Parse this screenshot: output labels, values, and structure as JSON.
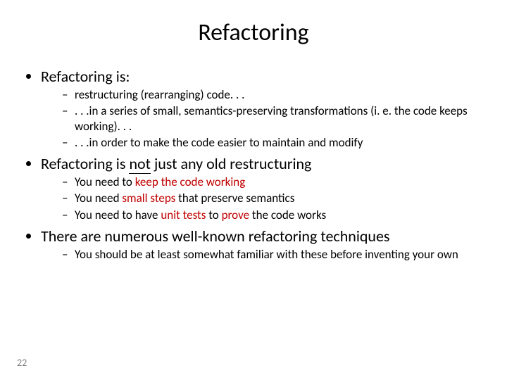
{
  "title": "Refactoring",
  "page_number": "22",
  "colors": {
    "accent_red": "#c00000"
  },
  "bullets": {
    "b1": {
      "heading": "Refactoring is:",
      "s1": "restructuring (rearranging) code. . .",
      "s2": ". . .in a series of small, semantics-preserving transformations (i. e. the code keeps working). . .",
      "s3": ". . .in order to make the code easier to maintain and modify"
    },
    "b2": {
      "heading_pre": "Refactoring is ",
      "heading_not": "not",
      "heading_post": " just any old restructuring",
      "s1_pre": "You need to ",
      "s1_em": "keep the code working",
      "s2_pre": "You need ",
      "s2_em": "small steps",
      "s2_post": " that preserve semantics",
      "s3_pre": "You need to have ",
      "s3_em": "unit tests",
      "s3_post": " to ",
      "s3_em2": "prove",
      "s3_post2": " the code works"
    },
    "b3": {
      "heading": "There are numerous well-known refactoring techniques",
      "s1": "You should be at least somewhat familiar with these before inventing your own"
    }
  }
}
